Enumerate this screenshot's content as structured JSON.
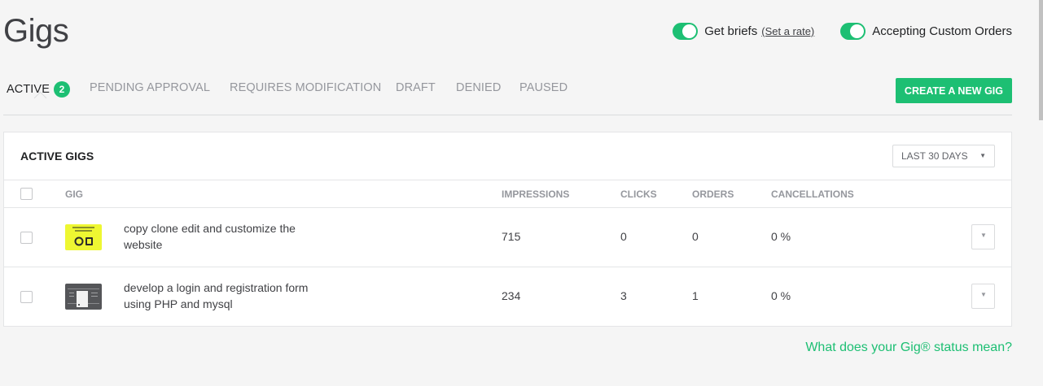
{
  "header": {
    "title": "Gigs"
  },
  "toggles": {
    "briefs_label": "Get briefs",
    "briefs_link": "(Set a rate)",
    "custom_orders_label": "Accepting Custom Orders"
  },
  "tabs": [
    {
      "label": "ACTIVE",
      "count": "2"
    },
    {
      "label": "PENDING APPROVAL"
    },
    {
      "label": "REQUIRES MODIFICATION"
    },
    {
      "label": "DRAFT"
    },
    {
      "label": "DENIED"
    },
    {
      "label": "PAUSED"
    }
  ],
  "create_button": "CREATE A NEW GIG",
  "panel": {
    "title": "ACTIVE GIGS",
    "period": "LAST 30 DAYS",
    "columns": [
      "GIG",
      "IMPRESSIONS",
      "CLICKS",
      "ORDERS",
      "CANCELLATIONS"
    ],
    "rows": [
      {
        "title": "copy clone edit and customize the website",
        "impressions": "715",
        "clicks": "0",
        "orders": "0",
        "cancellations": "0 %"
      },
      {
        "title": "develop a login and registration form using PHP and mysql",
        "impressions": "234",
        "clicks": "3",
        "orders": "1",
        "cancellations": "0 %"
      }
    ]
  },
  "footer_link": "What does your Gig® status mean?",
  "colors": {
    "accent": "#1dbf73",
    "background": "#f5f5f5"
  }
}
